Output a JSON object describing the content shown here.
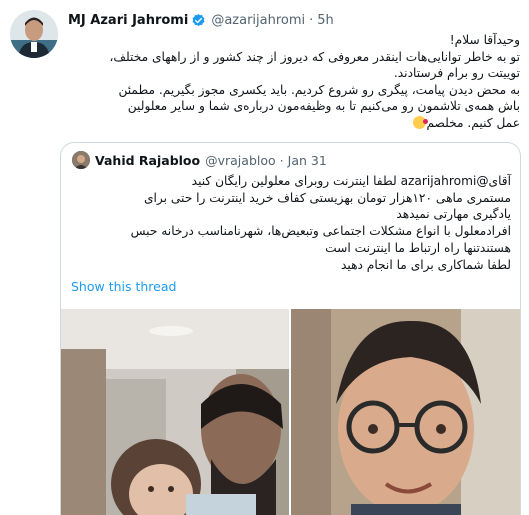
{
  "author": {
    "name": "MJ Azari Jahromi",
    "handle": "@azarijahromi",
    "separator": "·",
    "time": "5h"
  },
  "tweet": {
    "lines": [
      "وحیدآقا سلام!",
      "تو به خاطر توانایی‌هات اینقدر معروفی که دیروز از چند کشور و از راههای مختلف،",
      "تویيتت رو برام فرستادند.",
      "به محض دیدن پیامت، پیگری رو شروع کردیم. باید یکسری مجوز بگیریم. مطمئن",
      "باش همه‌ی تلاشمون رو می‌کنیم تا به وظیفه‌مون درباره‌ی شما و سایر معلولین",
      "عمل کنیم. مخلصم"
    ]
  },
  "quote": {
    "name": "Vahid Rajabloo",
    "handle": "@vrajabloo",
    "separator": "·",
    "date": "Jan 31",
    "mention": "@azarijahromi",
    "line1_prefix": "آقای",
    "line1_rest": "لطفا اینترنت روبرای معلولین رایگان کنید",
    "lines": [
      "مستمری ماهی ۱۲۰هزار تومان بهزیستی کفاف خرید اینترنت را حتی برای",
      "یادگیری مهارتی نمیدهد",
      "افرادمعلول با انواع مشکلات اجتماعی وتبعیض‌ها، شهرنامناسب درخانه حبس",
      "هستندتنها راه ارتباط ما اینترنت است",
      "لطفا شماکاری برای ما انجام دهید"
    ],
    "show_thread": "Show this thread"
  },
  "colors": {
    "link": "#1d9bf0",
    "verified": "#1d9bf0",
    "secondary_text": "#536471",
    "border": "#cfd9de"
  },
  "icons": {
    "verified": "verified-badge-icon",
    "emoji": "kiss-face-emoji-icon"
  }
}
